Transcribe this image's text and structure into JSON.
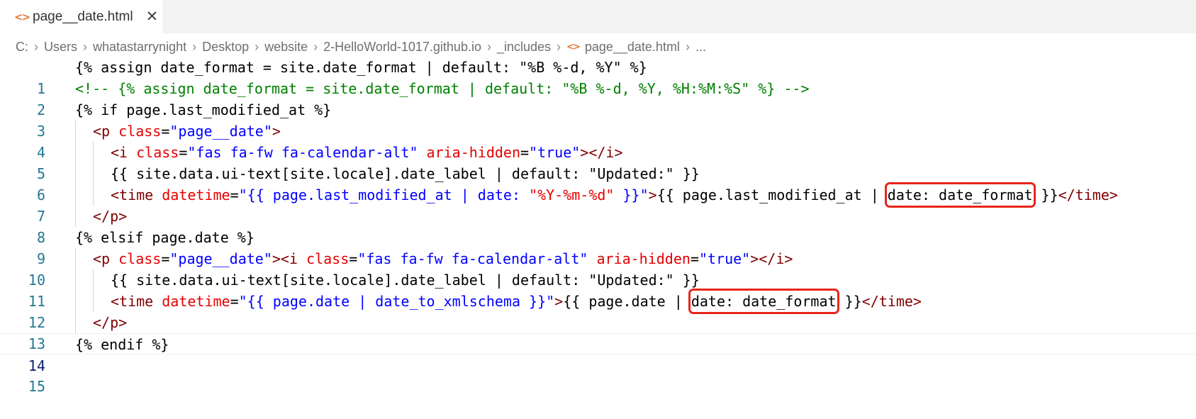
{
  "tab": {
    "icon": "code-file-icon",
    "label": "page__date.html",
    "close": "✕"
  },
  "breadcrumb": [
    "C:",
    "Users",
    "whatastarrynight",
    "Desktop",
    "website",
    "2-HelloWorld-1017.github.io",
    "_includes",
    "page__date.html",
    "..."
  ],
  "lines": [
    {
      "n": "1"
    },
    {
      "n": "2"
    },
    {
      "n": "3"
    },
    {
      "n": "4"
    },
    {
      "n": "5"
    },
    {
      "n": "6"
    },
    {
      "n": "7"
    },
    {
      "n": "8"
    },
    {
      "n": "9"
    },
    {
      "n": "10"
    },
    {
      "n": "11"
    },
    {
      "n": "12"
    },
    {
      "n": "13"
    },
    {
      "n": "14"
    },
    {
      "n": "15"
    }
  ],
  "code": {
    "l1": "{% assign date_format = site.date_format | default: \"%B %-d, %Y\" %}",
    "l2": "<!-- {% assign date_format = site.date_format | default: \"%B %-d, %Y, %H:%M:%S\" %} -->",
    "l3": "{% if page.last_modified_at %}",
    "l4": {
      "t1": "<p",
      "a1": " class",
      "eq": "=",
      "s1": "\"page__date\"",
      "t2": ">"
    },
    "l5": {
      "t1": "<i",
      "a1": " class",
      "eq1": "=",
      "s1": "\"fas fa-fw fa-calendar-alt\"",
      "a2": " aria-hidden",
      "eq2": "=",
      "s2": "\"true\"",
      "t2": "></i>"
    },
    "l6": "{{ site.data.ui-text[site.locale].date_label | default: \"Updated:\" }}",
    "l7": {
      "t1": "<time",
      "a1": " datetime",
      "eq": "=",
      "s1": "\"{{ page.last_modified_at | date: ",
      "s2": "\"%Y-%m-%d\"",
      "s3": " }}\"",
      "t2": ">",
      "p1": "{{ page.last_modified_at | ",
      "hl": "date: date_format",
      "p2": " }}",
      "t3": "</time>"
    },
    "l8": "</p>",
    "l9": "{% elsif page.date %}",
    "l10": {
      "t1": "<p",
      "a1": " class",
      "eq1": "=",
      "s1": "\"page__date\"",
      "t2": "><i",
      "a2": " class",
      "eq2": "=",
      "s2": "\"fas fa-fw fa-calendar-alt\"",
      "a3": " aria-hidden",
      "eq3": "=",
      "s3": "\"true\"",
      "t3": "></i>"
    },
    "l11": "{{ site.data.ui-text[site.locale].date_label | default: \"Updated:\" }}",
    "l12": {
      "t1": "<time",
      "a1": " datetime",
      "eq": "=",
      "s1": "\"{{ page.date | date_to_xmlschema }}\"",
      "t2": ">",
      "p1": "{{ page.date | ",
      "hl": "date: date_format",
      "p2": " }}",
      "t3": "</time>"
    },
    "l13": "</p>",
    "l14": "{% endif %}"
  }
}
